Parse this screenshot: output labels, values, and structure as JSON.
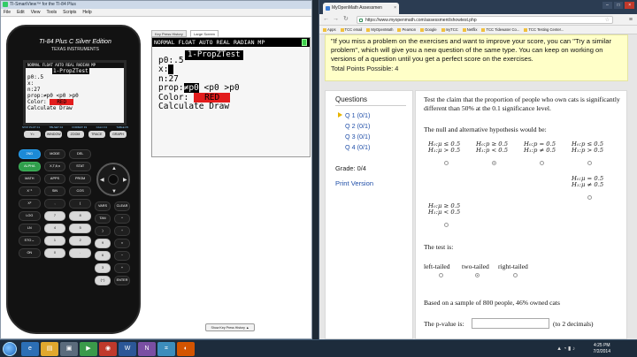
{
  "smartview": {
    "title": "TI-SmartView™ for the TI-84 Plus",
    "menu": [
      "File",
      "Edit",
      "View",
      "Tools",
      "Scripts",
      "Help"
    ],
    "calc": {
      "model": "TI-84 Plus C Silver Edition",
      "maker": "TEXAS INSTRUMENTS",
      "small_screen": {
        "status": "NORMAL FLOAT AUTO REAL RADIAN MP",
        "title": "1-PropZTest",
        "lines": [
          "p0:.5",
          "x:",
          "n:27",
          "prop:≠p0 <p0 >p0",
          "Color:",
          "Calculate Draw"
        ],
        "color_value": "RED"
      },
      "fkeys": [
        "Y=",
        "WINDOW",
        "ZOOM",
        "TRACE",
        "GRAPH"
      ],
      "fkey_labels": [
        "STAT PLOT F1",
        "TBLSET F2",
        "FORMAT F3",
        "CALC F4",
        "TABLE F5"
      ],
      "keys_left": [
        [
          "2ND",
          "MODE",
          "DEL"
        ],
        [
          "ALPHA",
          "X,T,θ,n",
          "STAT"
        ],
        [
          "MATH",
          "APPS",
          "PRGM"
        ],
        [
          "X⁻¹",
          "SIN",
          "COS"
        ],
        [
          "X²",
          ",",
          "("
        ],
        [
          "LOG",
          "7",
          "8"
        ],
        [
          "LN",
          "4",
          "5"
        ],
        [
          "STO→",
          "1",
          "2"
        ],
        [
          "ON",
          "0",
          "."
        ]
      ],
      "keys_right": [
        [
          "VARS",
          "CLEAR"
        ],
        [
          "TAN",
          "^"
        ],
        [
          ")",
          "÷"
        ],
        [
          "9",
          "×"
        ],
        [
          "6",
          "−"
        ],
        [
          "3",
          "+"
        ],
        [
          "(−)",
          "ENTER"
        ]
      ],
      "key_sups": [
        "QUIT",
        "INS",
        "A-LOCK",
        "LINK",
        "LIST",
        "TEST",
        "ANGLE",
        "DRAW",
        "DISTR",
        "MATRIX",
        "SIN⁻¹",
        "COS⁻¹",
        "TAN⁻¹",
        "π",
        "√",
        "EE",
        "{",
        "}",
        "e",
        "10ˣ",
        "u",
        "v",
        "w",
        "eˣ",
        "L4",
        "L5",
        "L6",
        "RCL",
        "L1",
        "L2",
        "L3",
        "MEM",
        "OFF",
        "CATALOG",
        "i",
        "ANS",
        "ENTRY SOLVE"
      ]
    },
    "tabs": [
      "Key Press History",
      "Large Screen"
    ],
    "active_tab": "Large Screen",
    "screen": {
      "status": "NORMAL FLOAT AUTO REAL RADIAN MP",
      "title": "1-PropZTest",
      "p0": "p0:.5",
      "x": "x:",
      "n": "n:27",
      "prop_label": "prop:",
      "prop_options": [
        "≠p0",
        "<p0",
        ">p0"
      ],
      "color_label": "Color:",
      "color_value": "RED",
      "calc_line": "Calculate Draw"
    },
    "show_history": "Show Key Press History ▲"
  },
  "browser": {
    "tab_title": "MyOpenMath Assessmen",
    "url": "https://www.myopenmath.com/assessment/showtest.php",
    "bookmarks": [
      "Apps",
      "TCC email",
      "MyOpenMath",
      "Pearson",
      "Google",
      "myTCC",
      "Netflix",
      "TCC Tidewater Co...",
      "TCC Testing Center..."
    ],
    "notice": "\"If you miss a problem on the exercises and want to improve your score, you can \"Try a similar problem\", which will give you a new question of the same type.  You can keep on working on versions of a question until you get a perfect score on the exercises.",
    "total_points": "Total Points Possible: 4",
    "questions_header": "Questions",
    "questions": [
      "Q 1 (0/1)",
      "Q 2 (0/1)",
      "Q 3 (0/1)",
      "Q 4 (0/1)"
    ],
    "grade": "Grade: 0/4",
    "print_version": "Print Version",
    "problem_text": "Test the claim that the proportion of people who own cats is significantly different than 50% at the 0.1 significance level.",
    "null_alt": "The null and alternative hypothesis would be:",
    "hypotheses": [
      {
        "h0": "H₀:μ ≤ 0.5",
        "h1": "H₁:μ > 0.5"
      },
      {
        "h0": "H₀:p ≥ 0.5",
        "h1": "H₁:p < 0.5"
      },
      {
        "h0": "H₀:p = 0.5",
        "h1": "H₁:p ≠ 0.5"
      },
      {
        "h0": "H₀:p ≤ 0.5",
        "h1": "H₁:p > 0.5"
      },
      {
        "h0": "H₀:μ = 0.5",
        "h1": "H₁:μ ≠ 0.5"
      },
      {
        "h0": "H₀:μ ≥ 0.5",
        "h1": "H₁:μ < 0.5"
      }
    ],
    "hypothesis_selected_index": 1,
    "test_is": "The test is:",
    "test_options": [
      "left-tailed",
      "two-tailed",
      "right-tailed"
    ],
    "test_selected_index": 1,
    "sample_text": "Based on a sample of 800 people, 46% owned cats",
    "pvalue_label": "The p-value is:",
    "pvalue_value": "",
    "pvalue_hint": "(to 2 decimals)"
  },
  "taskbar": {
    "time": "4:25 PM",
    "date": "7/2/2014"
  }
}
